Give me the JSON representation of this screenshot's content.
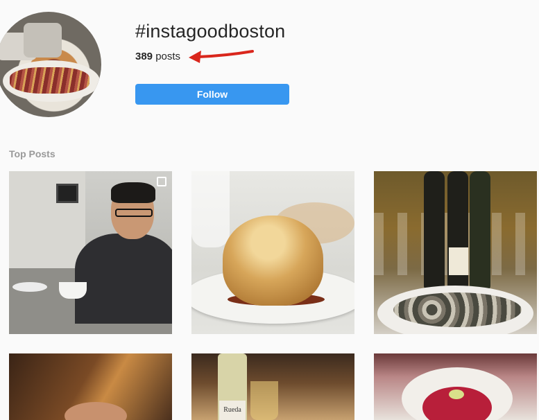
{
  "header": {
    "hashtag": "#instagoodboston",
    "post_count": "389",
    "post_count_suffix": "posts",
    "follow_label": "Follow"
  },
  "top_posts": {
    "label": "Top Posts",
    "label_5_text": "Rueda"
  },
  "colors": {
    "follow_button": "#3897f0",
    "annotation_arrow": "#d9261c"
  }
}
